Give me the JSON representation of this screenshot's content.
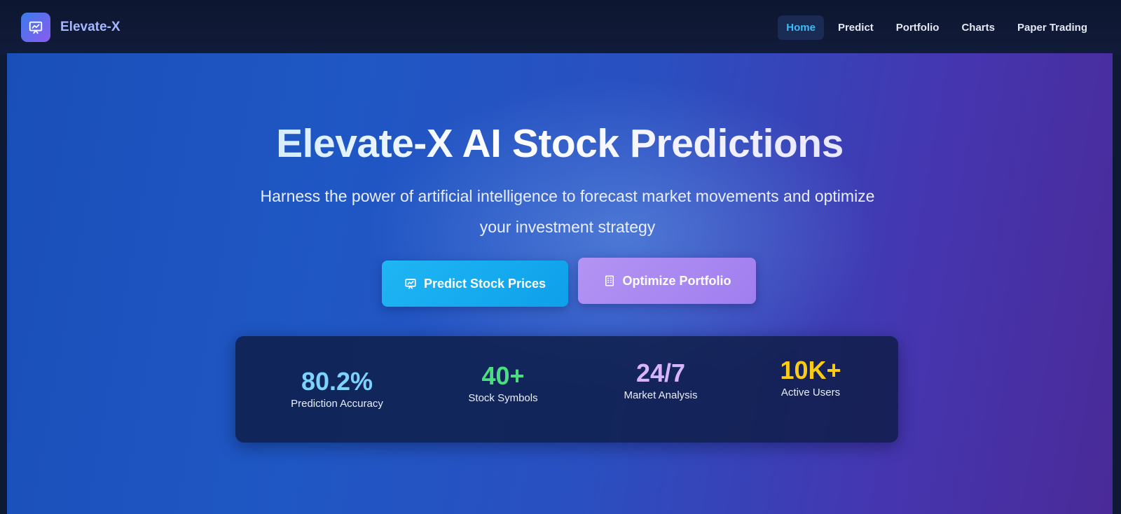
{
  "brand": {
    "name": "Elevate-X",
    "logo_icon": "chart-presentation-icon"
  },
  "nav": {
    "items": [
      {
        "label": "Home",
        "active": true
      },
      {
        "label": "Predict",
        "active": false
      },
      {
        "label": "Portfolio",
        "active": false
      },
      {
        "label": "Charts",
        "active": false
      },
      {
        "label": "Paper Trading",
        "active": false
      }
    ]
  },
  "hero": {
    "title": "Elevate-X AI Stock Predictions",
    "subtitle": "Harness the power of artificial intelligence to forecast market movements and optimize your investment strategy",
    "buttons": {
      "predict": {
        "label": "Predict Stock Prices",
        "icon": "chart-presentation-icon",
        "color": "#0ea5e9"
      },
      "optimize": {
        "label": "Optimize Portfolio",
        "icon": "building-icon",
        "color": "#a78bfa"
      }
    }
  },
  "stats": [
    {
      "value": "80.2%",
      "label": "Prediction Accuracy",
      "color": "#7dd3fc"
    },
    {
      "value": "40+",
      "label": "Stock Symbols",
      "color": "#4ade80"
    },
    {
      "value": "24/7",
      "label": "Market Analysis",
      "color": "#d8b4fe"
    },
    {
      "value": "10K+",
      "label": "Active Users",
      "color": "#facc15"
    }
  ],
  "colors": {
    "accent": "#38bdf8",
    "brand_text": "#a5b8ff"
  }
}
